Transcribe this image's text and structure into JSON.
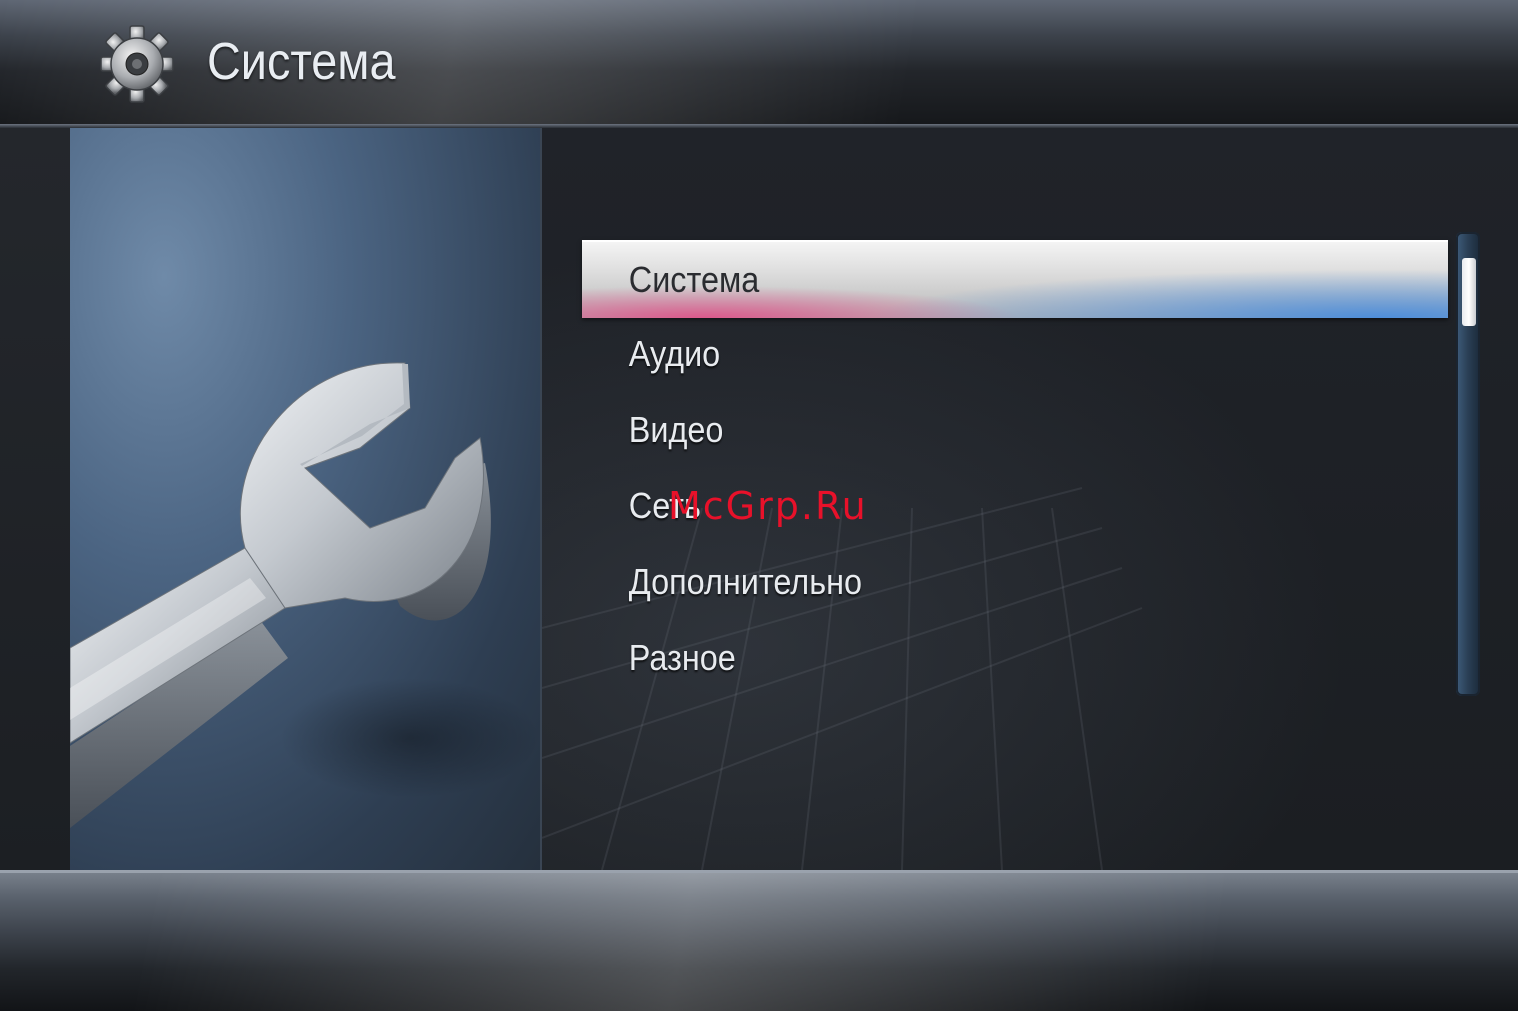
{
  "header": {
    "title": "Система",
    "icon": "gear-icon"
  },
  "menu": {
    "items": [
      {
        "label": "Система",
        "selected": true
      },
      {
        "label": "Аудио",
        "selected": false
      },
      {
        "label": "Видео",
        "selected": false
      },
      {
        "label": "Сеть",
        "selected": false
      },
      {
        "label": "Дополнительно",
        "selected": false
      },
      {
        "label": "Разное",
        "selected": false
      }
    ]
  },
  "side_illustration": {
    "icon": "wrench-icon"
  },
  "watermark": "McGrp.Ru",
  "colors": {
    "selection_pink": "#e24884",
    "selection_blue": "#488cdc",
    "watermark_red": "#e8112a"
  }
}
